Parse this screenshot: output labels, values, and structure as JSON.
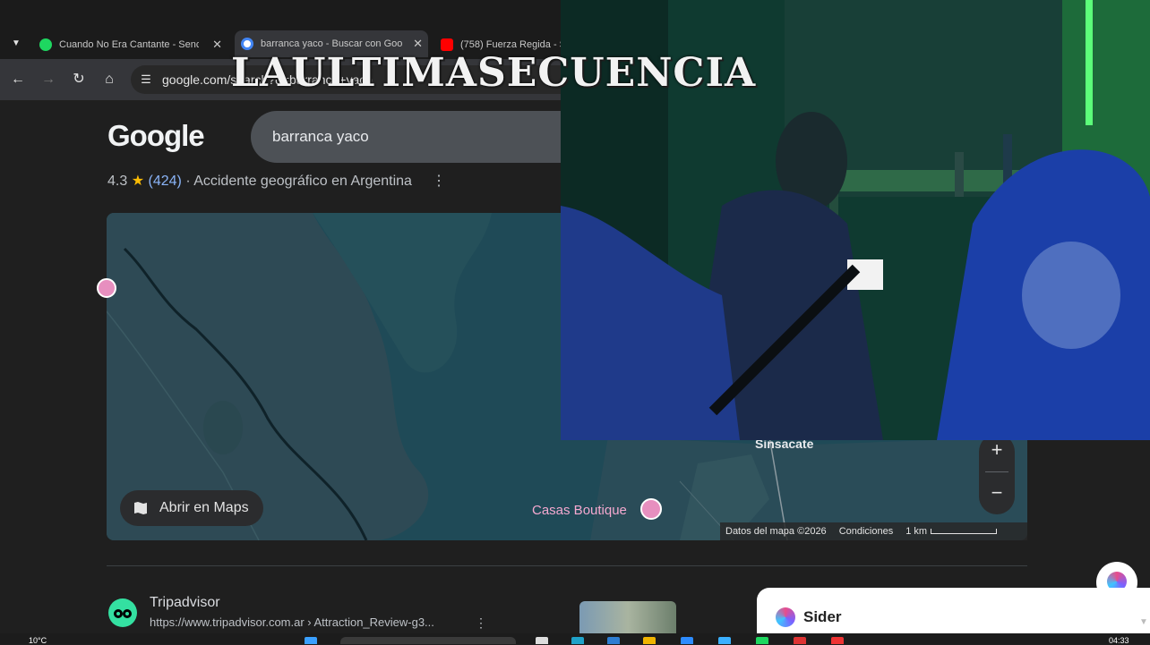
{
  "browser": {
    "tabs": [
      {
        "title": "Cuando No Era Cantante - Senc",
        "favicon": "spotify-icon",
        "color": "#1ed760"
      },
      {
        "title": "barranca yaco - Buscar con Goo",
        "favicon": "google-icon",
        "color": "#4285f4",
        "active": true
      },
      {
        "title": "(758) Fuerza Regida - S",
        "favicon": "youtube-icon",
        "color": "#ff0000"
      }
    ],
    "tab_close_glyph": "✕",
    "address": "google.com/search?q=barranca+yaco"
  },
  "search": {
    "logo": "Google",
    "query": "barranca yaco"
  },
  "place": {
    "rating": "4.3",
    "star": "★",
    "review_count": "(424)",
    "separator": "·",
    "category": "Accidente geográfico en Argentina"
  },
  "map": {
    "open_in_maps_label": "Abrir en Maps",
    "zoom_in": "+",
    "zoom_out": "−",
    "labels": {
      "sinsacate": "Sinsacate",
      "casas_boutique": "Casas Boutique"
    },
    "footer": {
      "attribution": "Datos del mapa ©2026",
      "terms": "Condiciones",
      "scale": "1 km"
    }
  },
  "results": [
    {
      "source": "Tripadvisor",
      "url": "https://www.tripadvisor.com.ar › Attraction_Review-g3..."
    }
  ],
  "sider": {
    "label": "Sider"
  },
  "overlay": {
    "watermark": "LAULTIMASECUENCIA"
  },
  "taskbar": {
    "weather": "10°C",
    "clock": "04:33"
  }
}
